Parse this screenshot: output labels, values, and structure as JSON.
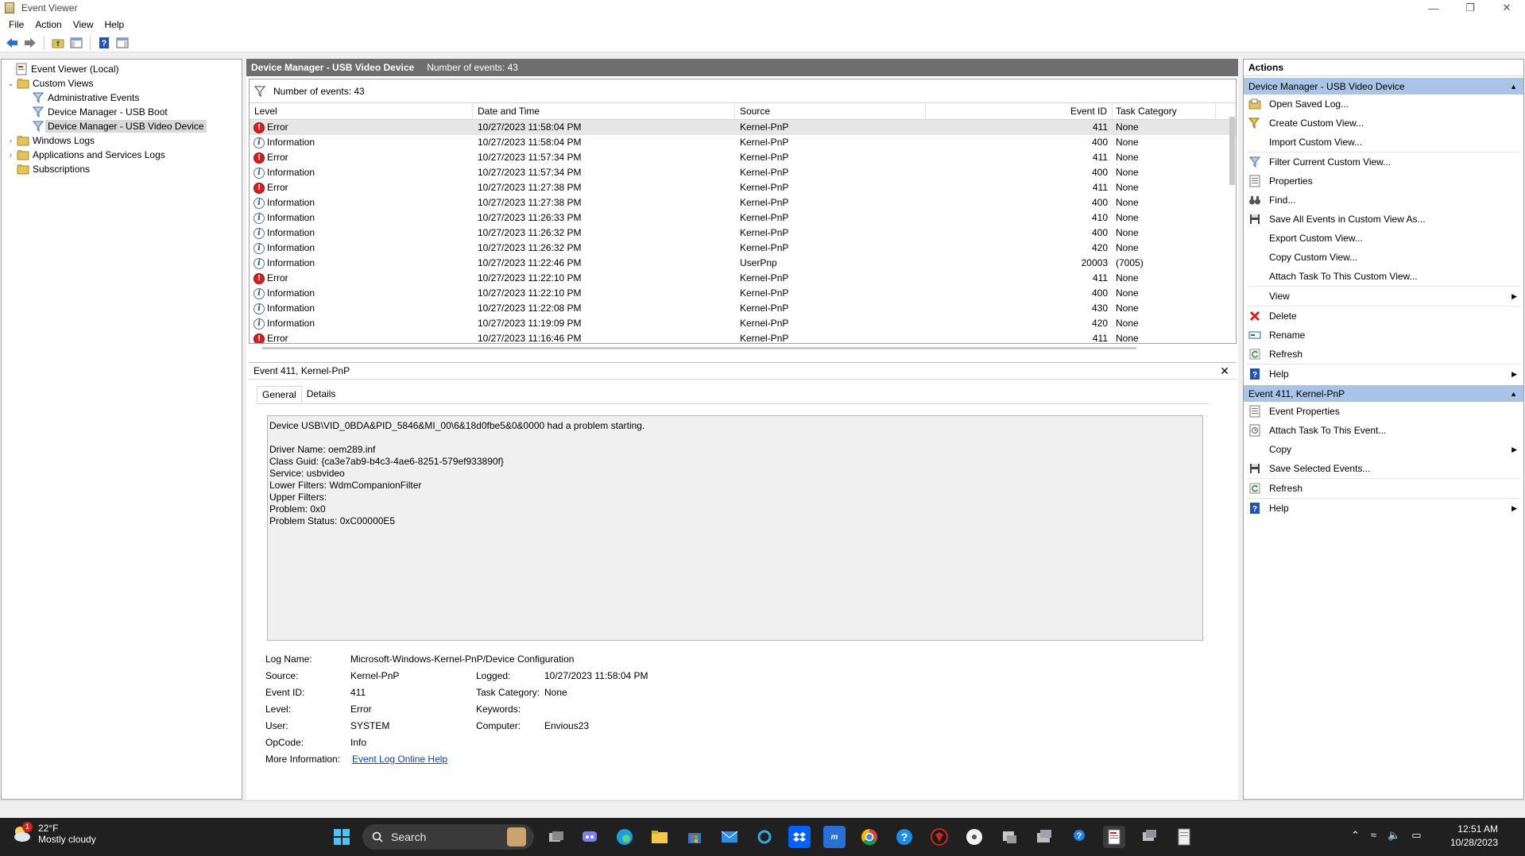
{
  "window": {
    "title": "Event Viewer"
  },
  "menu": [
    "File",
    "Action",
    "View",
    "Help"
  ],
  "tree": [
    {
      "label": "Event Viewer (Local)",
      "icon": "event-viewer-icon",
      "level": 0,
      "expander": ""
    },
    {
      "label": "Custom Views",
      "icon": "folder-icon",
      "level": 1,
      "expander": "⌄"
    },
    {
      "label": "Administrative Events",
      "icon": "filter-icon",
      "level": 2,
      "expander": ""
    },
    {
      "label": "Device Manager - USB Boot",
      "icon": "filter-icon",
      "level": 2,
      "expander": ""
    },
    {
      "label": "Device Manager - USB Video Device",
      "icon": "filter-icon",
      "level": 2,
      "expander": "",
      "selected": true
    },
    {
      "label": "Windows Logs",
      "icon": "folder-icon",
      "level": 1,
      "expander": "›"
    },
    {
      "label": "Applications and Services Logs",
      "icon": "folder-icon",
      "level": 1,
      "expander": "›"
    },
    {
      "label": "Subscriptions",
      "icon": "folder-icon",
      "level": 1,
      "expander": ""
    }
  ],
  "center": {
    "title": "Device Manager - USB Video Device",
    "count_label": "Number of events: 43",
    "filter_label": "Number of events: 43"
  },
  "grid": {
    "columns": [
      "Level",
      "Date and Time",
      "Source",
      "Event ID",
      "Task Category"
    ],
    "rows": [
      {
        "level": "Error",
        "date": "10/27/2023 11:58:04 PM",
        "source": "Kernel-PnP",
        "eid": "411",
        "task": "None"
      },
      {
        "level": "Information",
        "date": "10/27/2023 11:58:04 PM",
        "source": "Kernel-PnP",
        "eid": "400",
        "task": "None"
      },
      {
        "level": "Error",
        "date": "10/27/2023 11:57:34 PM",
        "source": "Kernel-PnP",
        "eid": "411",
        "task": "None"
      },
      {
        "level": "Information",
        "date": "10/27/2023 11:57:34 PM",
        "source": "Kernel-PnP",
        "eid": "400",
        "task": "None"
      },
      {
        "level": "Error",
        "date": "10/27/2023 11:27:38 PM",
        "source": "Kernel-PnP",
        "eid": "411",
        "task": "None"
      },
      {
        "level": "Information",
        "date": "10/27/2023 11:27:38 PM",
        "source": "Kernel-PnP",
        "eid": "400",
        "task": "None"
      },
      {
        "level": "Information",
        "date": "10/27/2023 11:26:33 PM",
        "source": "Kernel-PnP",
        "eid": "410",
        "task": "None"
      },
      {
        "level": "Information",
        "date": "10/27/2023 11:26:32 PM",
        "source": "Kernel-PnP",
        "eid": "400",
        "task": "None"
      },
      {
        "level": "Information",
        "date": "10/27/2023 11:26:32 PM",
        "source": "Kernel-PnP",
        "eid": "420",
        "task": "None"
      },
      {
        "level": "Information",
        "date": "10/27/2023 11:22:46 PM",
        "source": "UserPnp",
        "eid": "20003",
        "task": "(7005)"
      },
      {
        "level": "Error",
        "date": "10/27/2023 11:22:10 PM",
        "source": "Kernel-PnP",
        "eid": "411",
        "task": "None"
      },
      {
        "level": "Information",
        "date": "10/27/2023 11:22:10 PM",
        "source": "Kernel-PnP",
        "eid": "400",
        "task": "None"
      },
      {
        "level": "Information",
        "date": "10/27/2023 11:22:08 PM",
        "source": "Kernel-PnP",
        "eid": "430",
        "task": "None"
      },
      {
        "level": "Information",
        "date": "10/27/2023 11:19:09 PM",
        "source": "Kernel-PnP",
        "eid": "420",
        "task": "None"
      },
      {
        "level": "Error",
        "date": "10/27/2023 11:16:46 PM",
        "source": "Kernel-PnP",
        "eid": "411",
        "task": "None"
      }
    ]
  },
  "detail": {
    "title": "Event 411, Kernel-PnP",
    "tabs": [
      "General",
      "Details"
    ],
    "message": "Device USB\\VID_0BDA&PID_5846&MI_00\\6&18d0fbe5&0&0000 had a problem starting.\n\nDriver Name: oem289.inf\nClass Guid: {ca3e7ab9-b4c3-4ae6-8251-579ef933890f}\nService: usbvideo\nLower Filters: WdmCompanionFilter\nUpper Filters:\nProblem: 0x0\nProblem Status: 0xC00000E5",
    "log_name_label": "Log Name:",
    "log_name": "Microsoft-Windows-Kernel-PnP/Device Configuration",
    "source_label": "Source:",
    "source": "Kernel-PnP",
    "logged_label": "Logged:",
    "logged": "10/27/2023 11:58:04 PM",
    "eid_label": "Event ID:",
    "eid": "411",
    "task_label": "Task Category:",
    "task": "None",
    "level_label": "Level:",
    "level": "Error",
    "keywords_label": "Keywords:",
    "keywords": "",
    "user_label": "User:",
    "user": "SYSTEM",
    "computer_label": "Computer:",
    "computer": "Envious23",
    "opcode_label": "OpCode:",
    "opcode": "Info",
    "moreinfo_label": "More Information:",
    "moreinfo_link": "Event Log Online Help"
  },
  "actions": {
    "title": "Actions",
    "group1": "Device Manager - USB Video Device",
    "group1_items": [
      {
        "label": "Open Saved Log...",
        "icon": "open-log-icon",
        "sub": false
      },
      {
        "label": "Create Custom View...",
        "icon": "create-filter-icon",
        "sub": false
      },
      {
        "label": "Import Custom View...",
        "icon": "",
        "sub": false
      },
      {
        "sep": true
      },
      {
        "label": "Filter Current Custom View...",
        "icon": "filter-icon",
        "sub": false
      },
      {
        "label": "Properties",
        "icon": "properties-icon",
        "sub": false
      },
      {
        "label": "Find...",
        "icon": "binoculars-icon",
        "sub": false
      },
      {
        "label": "Save All Events in Custom View As...",
        "icon": "save-icon",
        "sub": false
      },
      {
        "label": "Export Custom View...",
        "icon": "",
        "sub": false
      },
      {
        "label": "Copy Custom View...",
        "icon": "",
        "sub": false
      },
      {
        "label": "Attach Task To This Custom View...",
        "icon": "",
        "sub": false
      },
      {
        "sep": true
      },
      {
        "label": "View",
        "icon": "",
        "sub": true
      },
      {
        "sep": true
      },
      {
        "label": "Delete",
        "icon": "delete-icon",
        "sub": false
      },
      {
        "label": "Rename",
        "icon": "rename-icon",
        "sub": false
      },
      {
        "label": "Refresh",
        "icon": "refresh-icon",
        "sub": false
      },
      {
        "sep": true
      },
      {
        "label": "Help",
        "icon": "help-icon",
        "sub": true
      }
    ],
    "group2": "Event 411, Kernel-PnP",
    "group2_items": [
      {
        "label": "Event Properties",
        "icon": "properties-icon",
        "sub": false
      },
      {
        "label": "Attach Task To This Event...",
        "icon": "task-icon",
        "sub": false
      },
      {
        "label": "Copy",
        "icon": "",
        "sub": true
      },
      {
        "label": "Save Selected Events...",
        "icon": "save-icon",
        "sub": false
      },
      {
        "sep": true
      },
      {
        "label": "Refresh",
        "icon": "refresh-icon",
        "sub": false
      },
      {
        "sep": true
      },
      {
        "label": "Help",
        "icon": "help-icon",
        "sub": true
      }
    ]
  },
  "taskbar": {
    "weather_temp": "22°F",
    "weather_cond": "Mostly cloudy",
    "weather_badge": "1",
    "search": "Search",
    "time": "12:51 AM",
    "date": "10/28/2023"
  },
  "colors": {
    "header": "#6e6e6e",
    "action_group": "#a9c4e6",
    "error": "#d32222",
    "link": "#0645ad"
  }
}
